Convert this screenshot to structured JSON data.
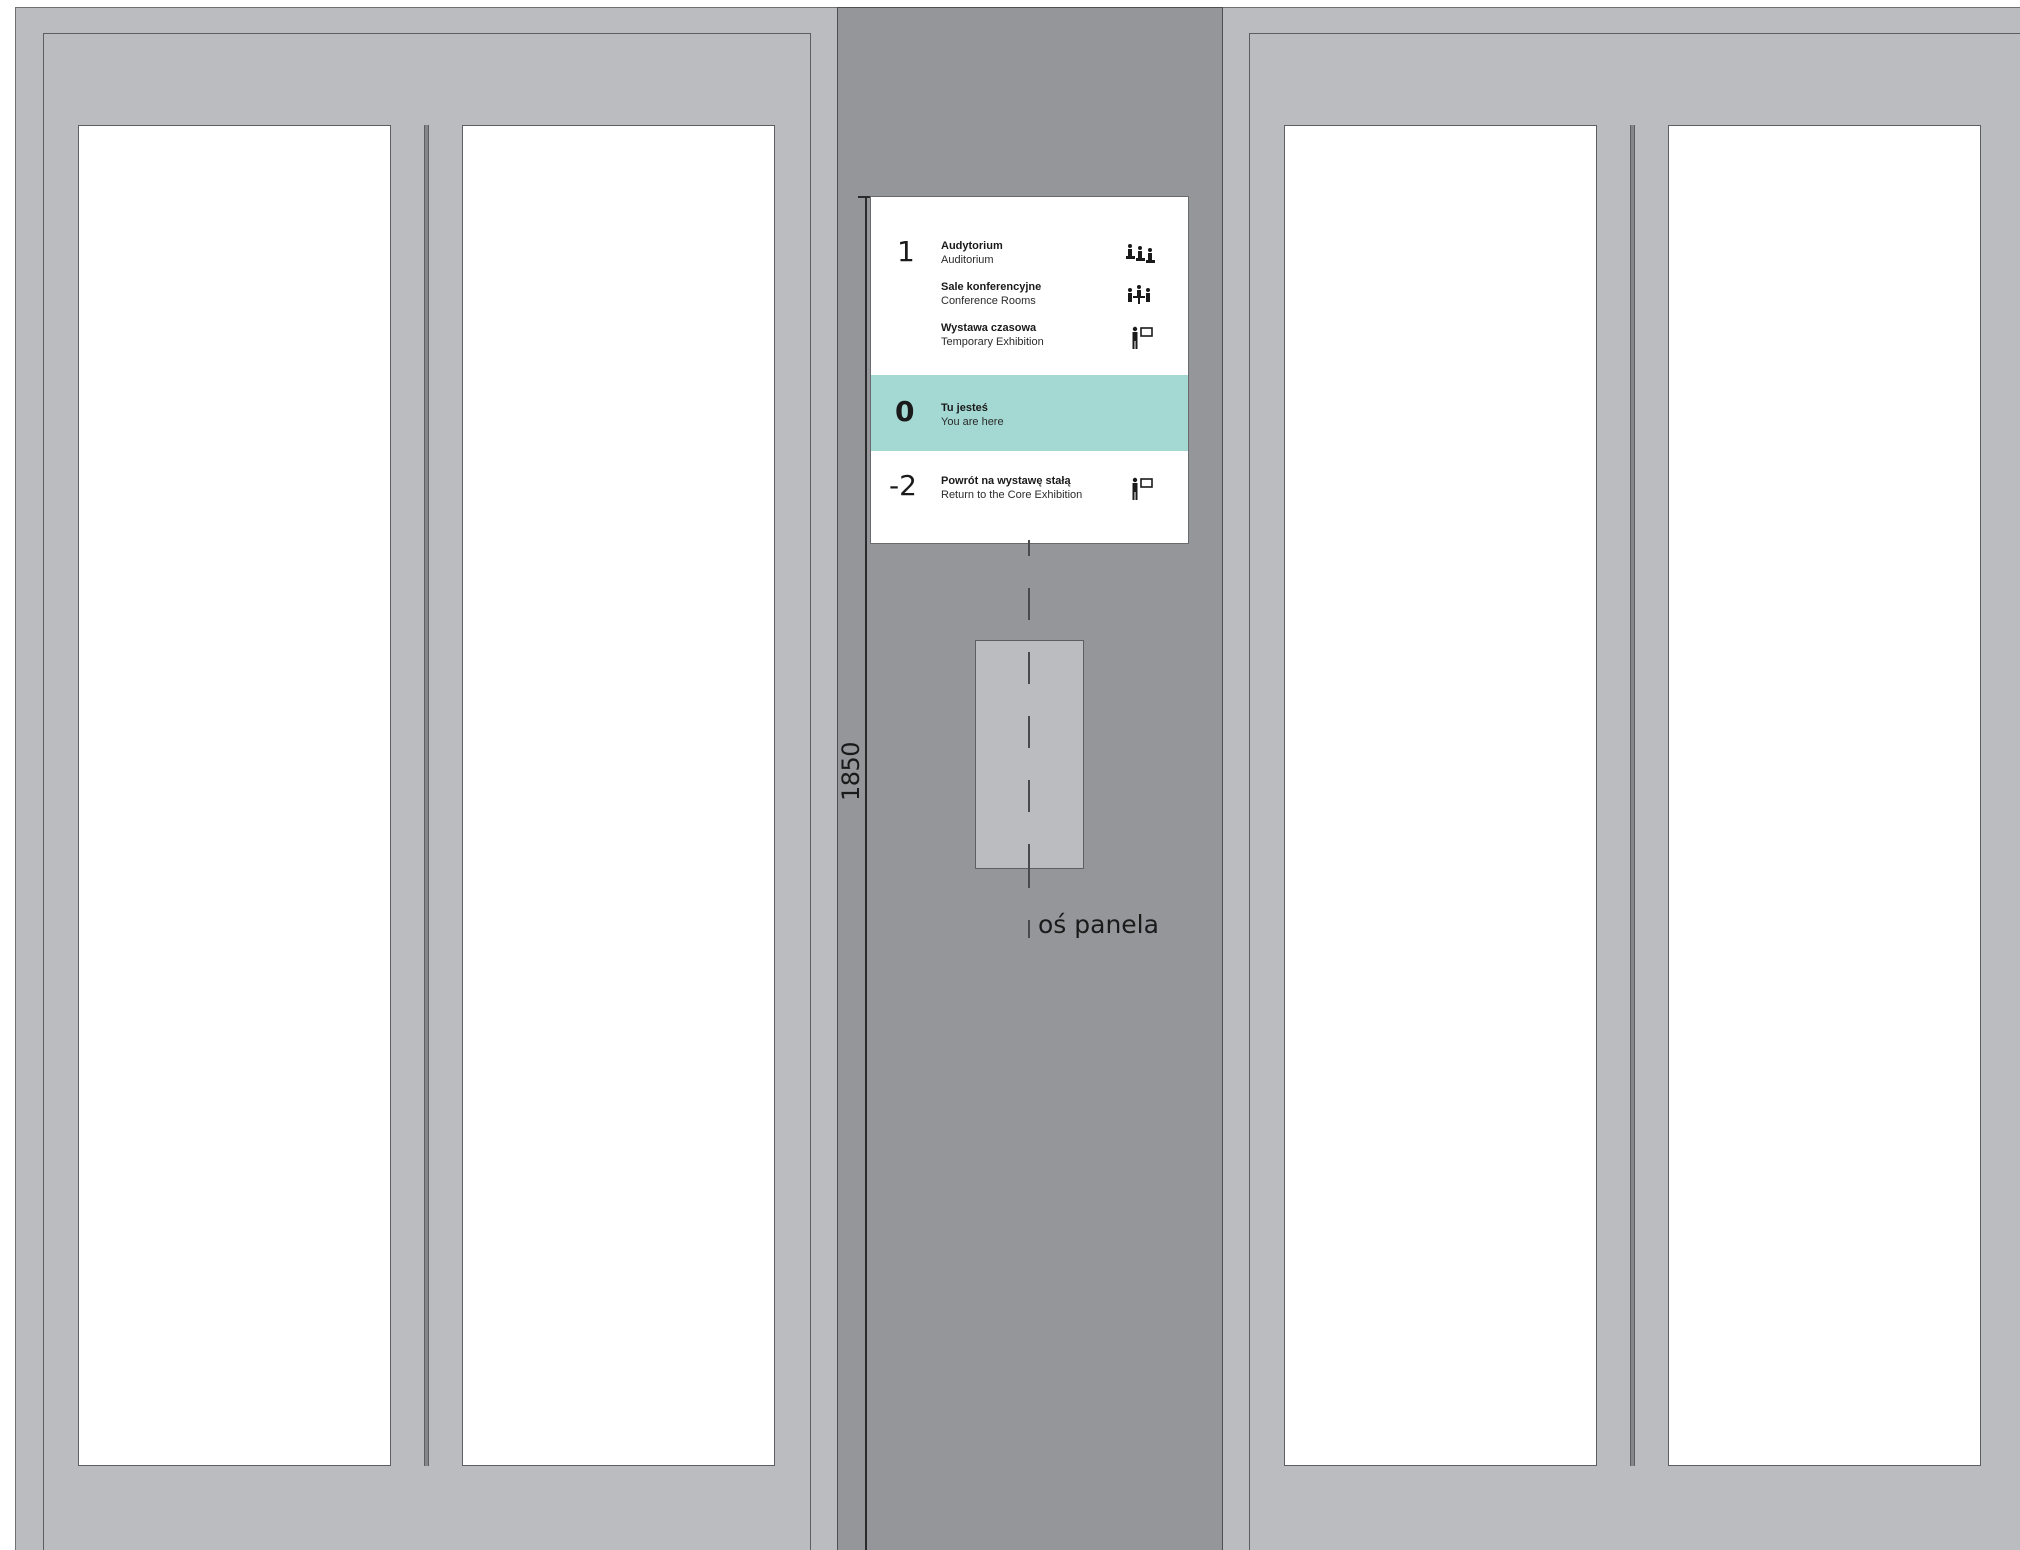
{
  "dimension": {
    "height_label": "1850"
  },
  "sign": {
    "floors": [
      {
        "number": "1",
        "entries": [
          {
            "pl": "Audytorium",
            "en": "Auditorium",
            "icon": "auditorium-seats-icon"
          },
          {
            "pl": "Sale konferencyjne",
            "en": "Conference Rooms",
            "icon": "conference-table-icon"
          },
          {
            "pl": "Wystawa czasowa",
            "en": "Temporary Exhibition",
            "icon": "exhibition-visitor-icon"
          }
        ]
      },
      {
        "number": "0",
        "highlight_color": "#a4d8d3",
        "entries": [
          {
            "pl": "Tu jesteś",
            "en": "You are here"
          }
        ]
      },
      {
        "number": "-2",
        "entries": [
          {
            "pl": "Powrót na wystawę stałą",
            "en": "Return to the Core Exhibition",
            "icon": "exhibition-visitor-icon"
          }
        ]
      }
    ]
  },
  "axis": {
    "label": "oś panela"
  },
  "colors": {
    "wall": "#bbbcc0",
    "column": "#959699",
    "glass": "#ffffff",
    "highlight": "#a4d8d3"
  }
}
